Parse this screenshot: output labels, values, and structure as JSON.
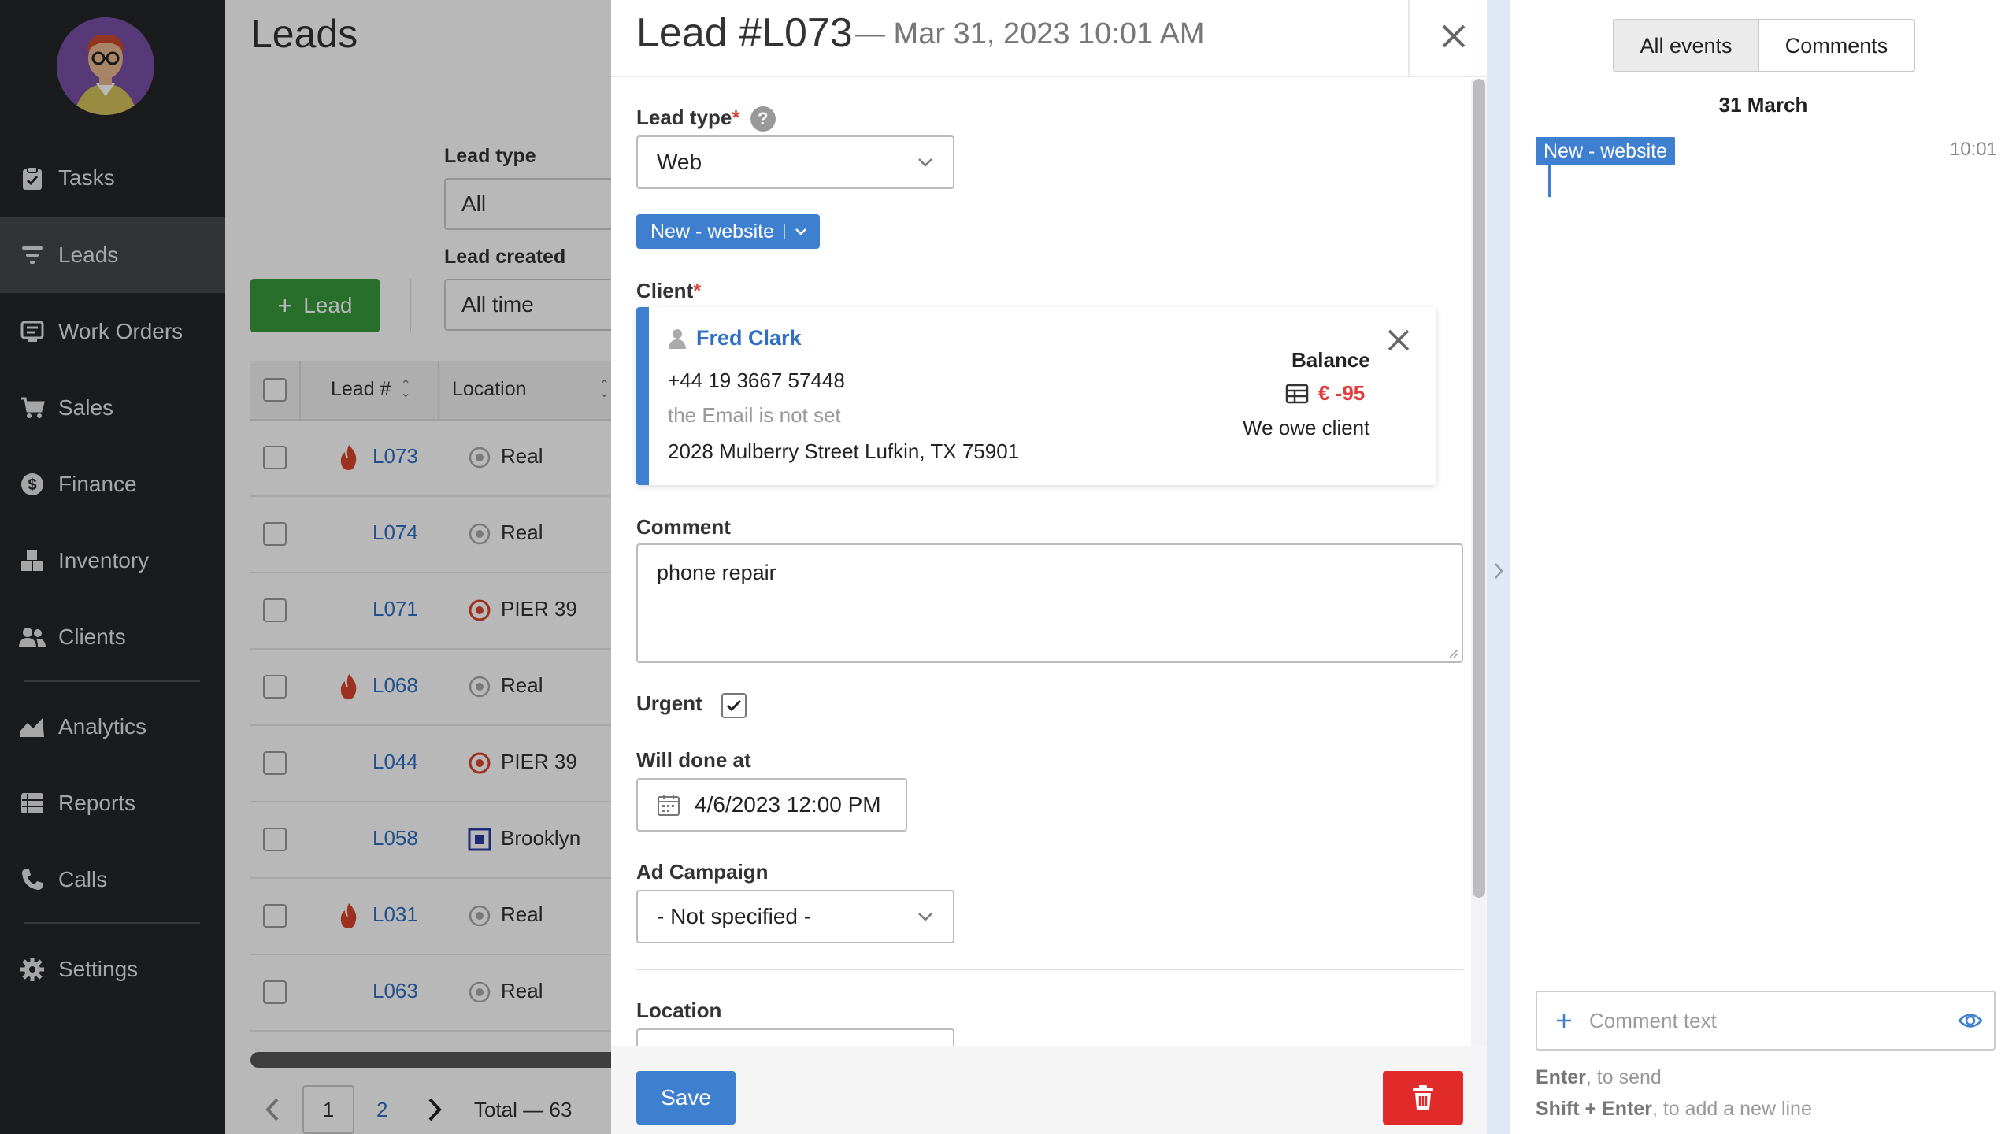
{
  "sidebar": {
    "items": [
      {
        "label": "Tasks",
        "icon": "clipboard-check-icon"
      },
      {
        "label": "Leads",
        "icon": "funnel-icon"
      },
      {
        "label": "Work Orders",
        "icon": "monitor-icon"
      },
      {
        "label": "Sales",
        "icon": "cart-icon"
      },
      {
        "label": "Finance",
        "icon": "dollar-icon"
      },
      {
        "label": "Inventory",
        "icon": "boxes-icon"
      },
      {
        "label": "Clients",
        "icon": "users-icon"
      },
      {
        "label": "Analytics",
        "icon": "chart-area-icon"
      },
      {
        "label": "Reports",
        "icon": "list-icon"
      },
      {
        "label": "Calls",
        "icon": "phone-icon"
      },
      {
        "label": "Settings",
        "icon": "gear-icon"
      }
    ],
    "active_item": "Leads"
  },
  "list_page": {
    "title": "Leads",
    "filters": {
      "lead_type_label": "Lead type",
      "lead_type_value": "All",
      "lead_created_label": "Lead created",
      "lead_created_value": "All time"
    },
    "add_button": "Lead",
    "columns": [
      "Lead #",
      "Location"
    ],
    "rows": [
      {
        "lead": "L073",
        "urgent": true,
        "location": "Real",
        "loc_icon": "circle-dot"
      },
      {
        "lead": "L074",
        "urgent": false,
        "location": "Real",
        "loc_icon": "circle-dot"
      },
      {
        "lead": "L071",
        "urgent": false,
        "location": "PIER 39",
        "loc_icon": "target-red"
      },
      {
        "lead": "L068",
        "urgent": true,
        "location": "Real",
        "loc_icon": "circle-dot"
      },
      {
        "lead": "L044",
        "urgent": false,
        "location": "PIER 39",
        "loc_icon": "target-red"
      },
      {
        "lead": "L058",
        "urgent": false,
        "location": "Brooklyn",
        "loc_icon": "square-blue"
      },
      {
        "lead": "L031",
        "urgent": true,
        "location": "Real",
        "loc_icon": "circle-dot"
      },
      {
        "lead": "L063",
        "urgent": false,
        "location": "Real",
        "loc_icon": "circle-dot"
      }
    ],
    "pagination": {
      "pages": [
        "1",
        "2"
      ],
      "current": "1",
      "total": "Total — 63"
    }
  },
  "modal": {
    "title": "Lead #L073",
    "subtitle": "— Mar 31, 2023 10:01 AM",
    "lead_type_label": "Lead type",
    "help": "?",
    "lead_type_value": "Web",
    "status": "New - website",
    "client_label": "Client",
    "client": {
      "name": "Fred Clark",
      "phone": "+44 19 3667 57448",
      "email": "the Email is not set",
      "address": "2028 Mulberry Street Lufkin, TX 75901",
      "balance_label": "Balance",
      "balance_value": "€ -95",
      "balance_note": "We owe client"
    },
    "comment_label": "Comment",
    "comment_value": "phone repair",
    "urgent_label": "Urgent",
    "urgent_checked": true,
    "will_done_label": "Will done at",
    "will_done_value": "4/6/2023 12:00 PM",
    "ad_campaign_label": "Ad Campaign",
    "ad_campaign_value": "- Not specified -",
    "location_label": "Location",
    "save_label": "Save"
  },
  "events_panel": {
    "tabs": [
      "All events",
      "Comments"
    ],
    "active_tab": "All events",
    "date": "31 March",
    "events": [
      {
        "label": "New - website",
        "time": "10:01"
      }
    ],
    "comment_placeholder": "Comment text",
    "hint_send_key": "Enter",
    "hint_send_text": ", to send",
    "hint_newline_key": "Shift + Enter",
    "hint_newline_text": ", to add a new line"
  },
  "colors": {
    "accent": "#3e7fcf",
    "danger": "#e12b2b",
    "success": "#3a9a3e",
    "sidebar": "#232629"
  }
}
